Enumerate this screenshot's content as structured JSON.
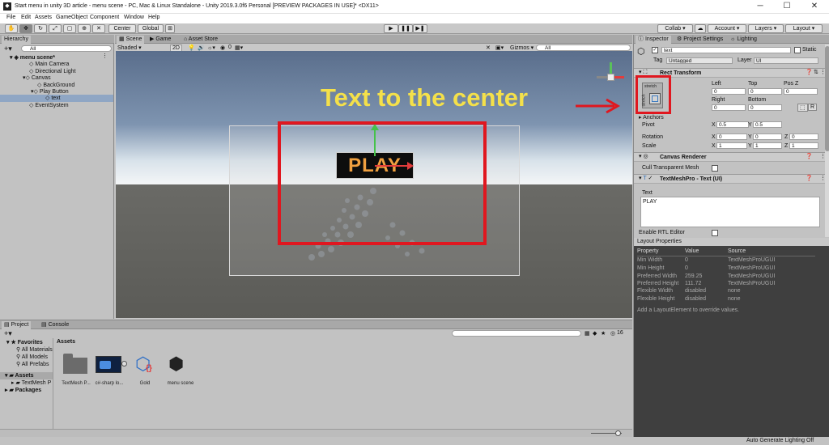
{
  "window": {
    "title": "Start menu in unity 3D article - menu scene - PC, Mac & Linux Standalone - Unity 2019.3.0f6 Personal [PREVIEW PACKAGES IN USE]* <DX11>",
    "minimize": "─",
    "maximize": "☐",
    "close": "✕"
  },
  "menu": [
    "File",
    "Edit",
    "Assets",
    "GameObject",
    "Component",
    "Window",
    "Help"
  ],
  "toolbar": {
    "pivot_label": "Center",
    "space_label": "Global",
    "collab_label": "Collab ▾",
    "account_label": "Account ▾",
    "layers_label": "Layers ▾",
    "layout_label": "Layout ▾"
  },
  "hierarchy": {
    "tab": "Hierarchy",
    "search_placeholder": "All",
    "items": [
      "menu scene*",
      "Main Camera",
      "Directional Light",
      "Canvas",
      "BackGround",
      "Play Button",
      "text",
      "EventSystem"
    ]
  },
  "scene_view": {
    "tabs": [
      "Scene",
      "Game",
      "Asset Store"
    ],
    "shading": "Shaded",
    "mode_2d": "2D",
    "gizmos_label": "Gizmos",
    "search_placeholder": "All",
    "button_text": "PLAY",
    "annotation": "Text to the center",
    "count_label": "0"
  },
  "inspector": {
    "tabs": [
      "Inspector",
      "Project Settings",
      "Lighting"
    ],
    "object_name": "text",
    "static_label": "Static",
    "tag_label": "Tag",
    "tag_value": "Untagged",
    "layer_label": "Layer",
    "layer_value": "UI",
    "rect_transform": {
      "title": "Rect Transform",
      "stretch_top": "stretch",
      "stretch_side": "stretch",
      "left_label": "Left",
      "top_label": "Top",
      "posz_label": "Pos Z",
      "left": "0",
      "top": "0",
      "posz": "0",
      "right_label": "Right",
      "bottom_label": "Bottom",
      "right": "0",
      "bottom": "0",
      "r_button": "R",
      "anchors_label": "Anchors",
      "pivot_label": "Pivot",
      "pivot_x": "0.5",
      "pivot_y": "0.5",
      "rotation_label": "Rotation",
      "rot_x": "0",
      "rot_y": "0",
      "rot_z": "0",
      "scale_label": "Scale",
      "scale_x": "1",
      "scale_y": "1",
      "scale_z": "1",
      "x_label": "X",
      "y_label": "Y",
      "z_label": "Z"
    },
    "canvas_renderer": {
      "title": "Canvas Renderer",
      "cull_label": "Cull Transparent Mesh"
    },
    "textmesh": {
      "title": "TextMeshPro - Text (UI)",
      "text_label": "Text",
      "text_value": "PLAY",
      "rtl_label": "Enable RTL Editor"
    },
    "layout_properties": {
      "title": "Layout Properties",
      "headers": [
        "Property",
        "Value",
        "Source"
      ],
      "rows": [
        [
          "Min Width",
          "0",
          "TextMeshProUGUI"
        ],
        [
          "Min Height",
          "0",
          "TextMeshProUGUI"
        ],
        [
          "Preferred Width",
          "259.25",
          "TextMeshProUGUI"
        ],
        [
          "Preferred Height",
          "111.72",
          "TextMeshProUGUI"
        ],
        [
          "Flexible Width",
          "disabled",
          "none"
        ],
        [
          "Flexible Height",
          "disabled",
          "none"
        ]
      ],
      "note": "Add a LayoutElement to override values."
    }
  },
  "project": {
    "tabs": [
      "Project",
      "Console"
    ],
    "favorites_label": "Favorites",
    "favorites": [
      "All Materials",
      "All Models",
      "All Prefabs"
    ],
    "assets_label": "Assets",
    "asset_children": [
      "TextMesh P"
    ],
    "packages_label": "Packages",
    "breadcrumb": "Assets",
    "badge_count": "16",
    "assets": [
      "TextMesh P...",
      "c#-sharp lo...",
      "Gold",
      "menu scene"
    ]
  },
  "status": {
    "text": "Auto Generate Lighting Off"
  },
  "colors": {
    "annotation": "#f4e04a",
    "highlight": "#e0171f",
    "play_text": "#f0a040",
    "play_bg": "#0d0d0d"
  }
}
